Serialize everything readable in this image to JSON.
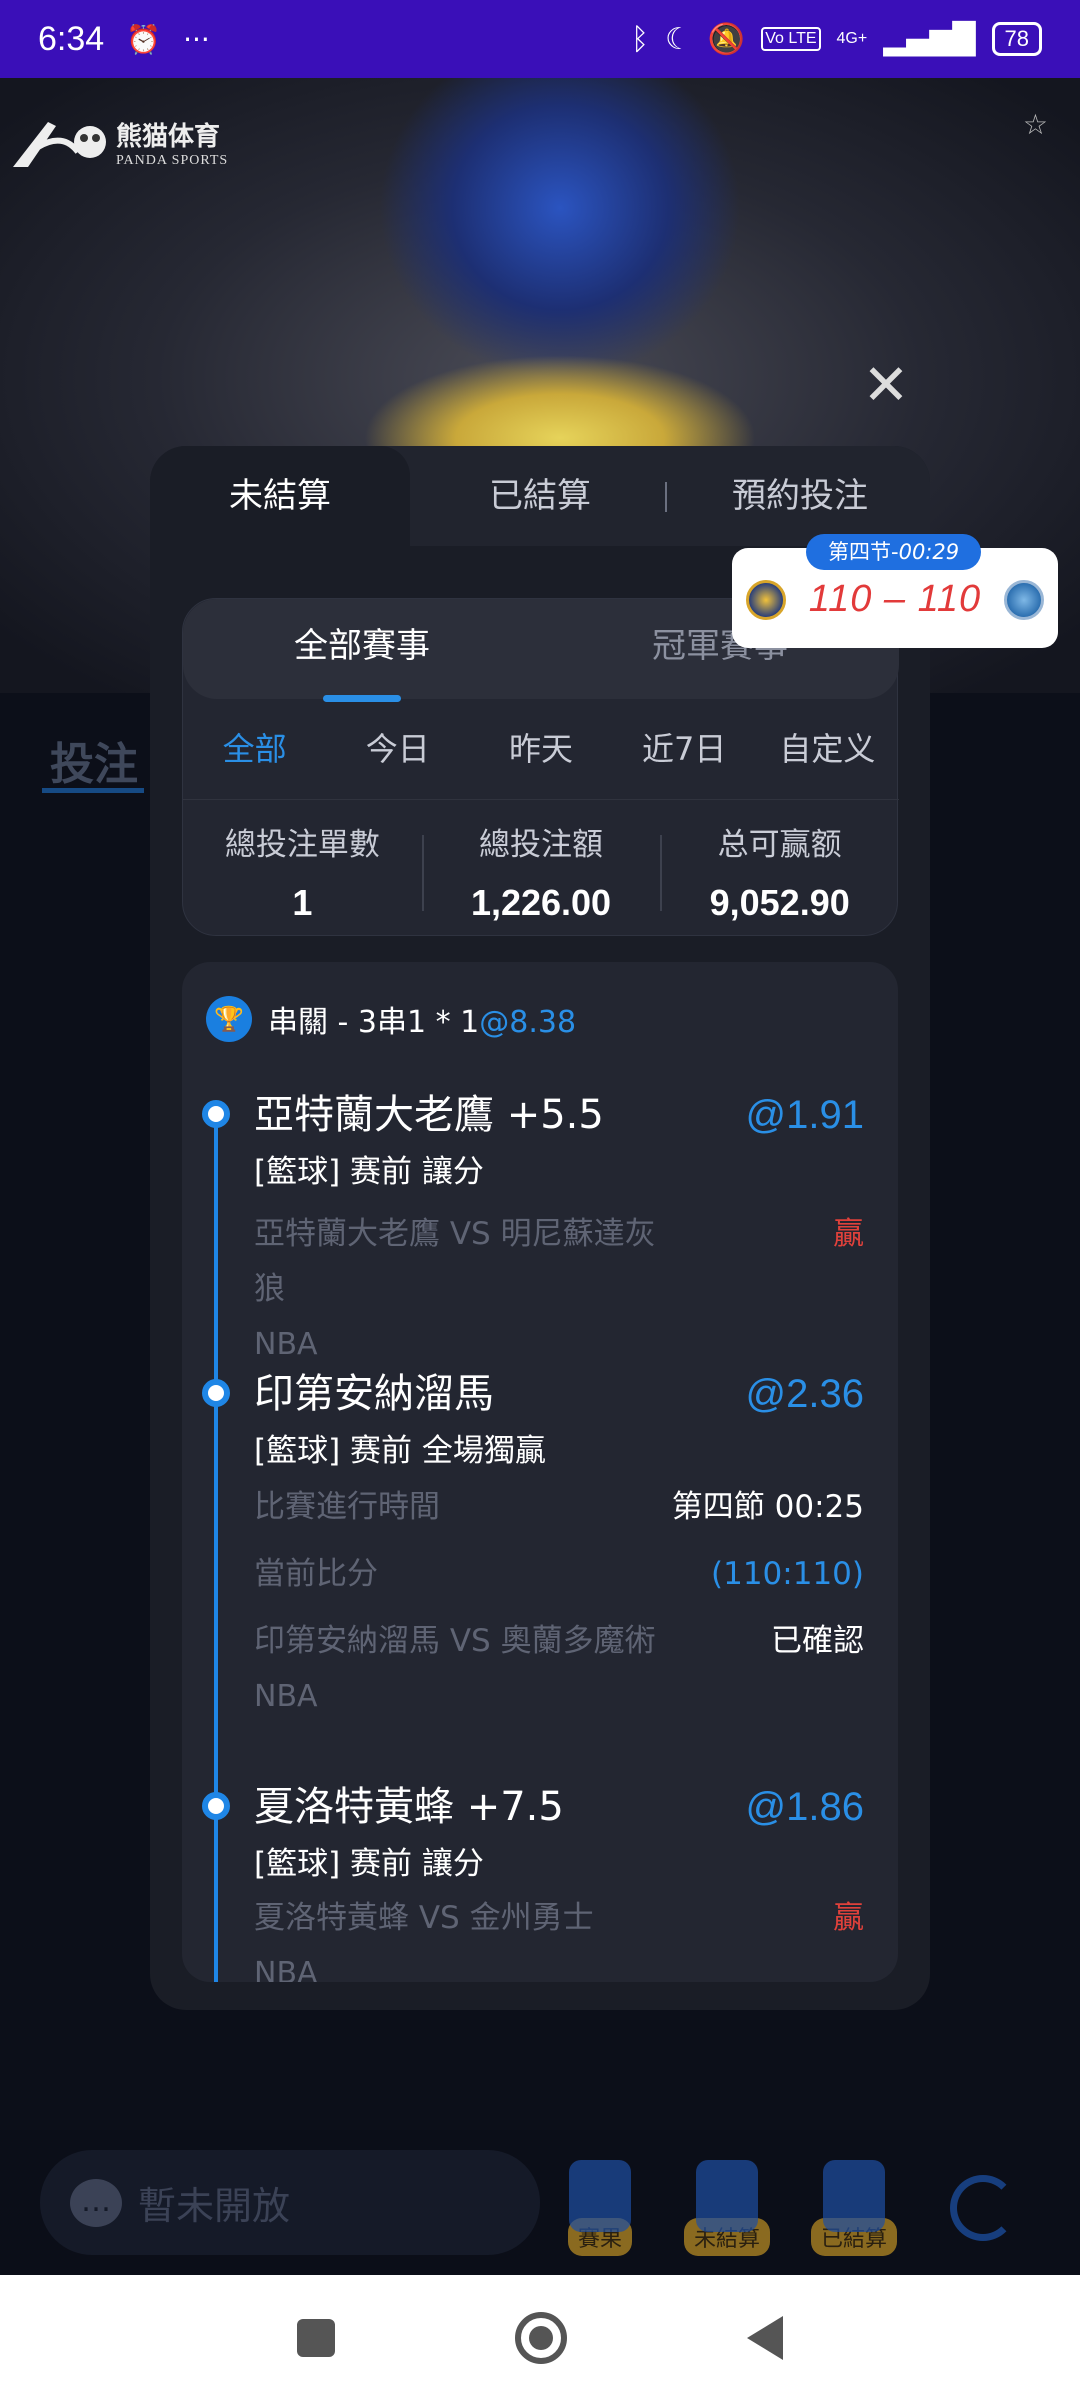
{
  "status_bar": {
    "time": "6:34",
    "network": "4G+",
    "lte": "Vo LTE",
    "battery": "78"
  },
  "video": {
    "logo_cn": "熊猫体育",
    "logo_en": "PANDA SPORTS"
  },
  "background": {
    "tab_label": "投注"
  },
  "modal": {
    "tabs": [
      {
        "label": "未結算",
        "active": true
      },
      {
        "label": "已結算",
        "active": false
      },
      {
        "label": "預約投注",
        "active": false
      }
    ],
    "segment": [
      {
        "label": "全部賽事",
        "active": true
      },
      {
        "label": "冠軍賽事",
        "active": false
      }
    ],
    "days": [
      {
        "label": "全部",
        "active": true
      },
      {
        "label": "今日",
        "active": false
      },
      {
        "label": "昨天",
        "active": false
      },
      {
        "label": "近7日",
        "active": false
      },
      {
        "label": "自定义",
        "active": false
      }
    ],
    "stats": [
      {
        "label": "總投注單數",
        "value": "1"
      },
      {
        "label": "總投注額",
        "value": "1,226.00"
      },
      {
        "label": "总可赢额",
        "value": "9,052.90"
      }
    ],
    "bet": {
      "title": "串關 - 3串1 * 1",
      "odds": "@8.38",
      "legs": [
        {
          "title": "亞特蘭大老鷹 +5.5",
          "odds": "@1.91",
          "sub": "[籃球] 赛前 讓分",
          "match": "亞特蘭大老鷹 VS 明尼蘇達灰狼",
          "result": "贏",
          "league": "NBA"
        },
        {
          "title": "印第安納溜馬",
          "odds": "@2.36",
          "sub": "[籃球] 赛前 全場獨贏",
          "time_label": "比賽進行時間",
          "time_value": "第四節  00:25",
          "score_label": "當前比分",
          "score_value": "(110:110)",
          "match": "印第安納溜馬 VS 奧蘭多魔術",
          "result": "已確認",
          "league": "NBA"
        },
        {
          "title": "夏洛特黃蜂 +7.5",
          "odds": "@1.86",
          "sub": "[籃球] 赛前 讓分",
          "match": "夏洛特黃蜂 VS 金州勇士",
          "result": "贏",
          "league": "NBA"
        }
      ]
    }
  },
  "score_popup": {
    "period": "第四节-",
    "clock": "00:29",
    "score": "110 – 110"
  },
  "bottom_bar": {
    "chat_placeholder": "暫未開放",
    "buttons": [
      "賽果",
      "未結算",
      "已結算"
    ]
  },
  "colors": {
    "status_bar": "#3a0fb8",
    "accent": "#2a8fe6",
    "win": "#e0413b",
    "modal_bg": "#1a1d26"
  }
}
